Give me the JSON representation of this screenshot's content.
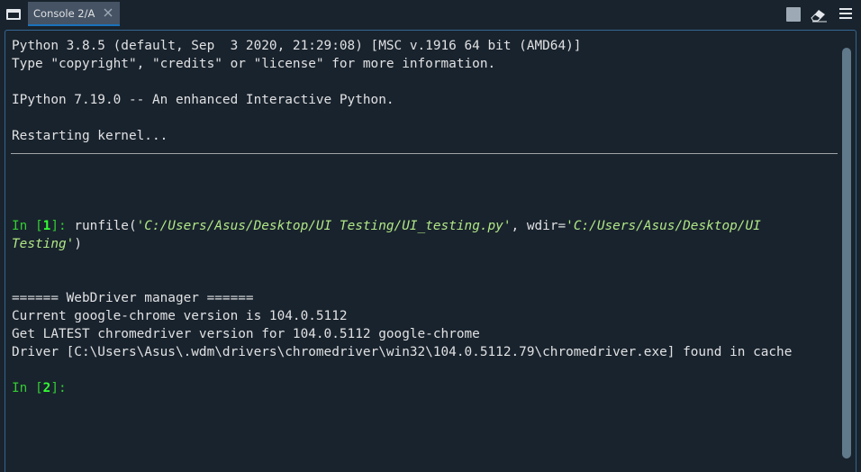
{
  "tabbar": {
    "window_icon": "window-icon",
    "tab_label": "Console 2/A",
    "close_icon": "close-icon",
    "stop_icon": "stop-icon",
    "eraser_icon": "eraser-icon",
    "menu_icon": "hamburger-menu-icon"
  },
  "console": {
    "banner_line1": "Python 3.8.5 (default, Sep  3 2020, 21:29:08) [MSC v.1916 64 bit (AMD64)]",
    "banner_line2": "Type \"copyright\", \"credits\" or \"license\" for more information.",
    "banner_line3": "IPython 7.19.0 -- An enhanced Interactive Python.",
    "restart_msg": "Restarting kernel...",
    "cell1": {
      "prompt_prefix": "In [",
      "prompt_num": "1",
      "prompt_suffix": "]: ",
      "code_start": "runfile(",
      "path_str": "'C:/Users/Asus/Desktop/UI Testing/UI_testing.py'",
      "code_mid": ", wdir=",
      "wdir_str_part1": "'C:/Users/Asus/Desktop/UI",
      "wdir_str_part2": "Testing'",
      "code_end": ")"
    },
    "output": [
      "====== WebDriver manager ======",
      "Current google-chrome version is 104.0.5112",
      "Get LATEST chromedriver version for 104.0.5112 google-chrome",
      "Driver [C:\\Users\\Asus\\.wdm\\drivers\\chromedriver\\win32\\104.0.5112.79\\chromedriver.exe] found in cache"
    ],
    "cell2": {
      "prompt_prefix": "In [",
      "prompt_num": "2",
      "prompt_suffix": "]:"
    }
  },
  "colors": {
    "background": "#19232d",
    "text": "#e0e1e3",
    "prompt": "#33cc33",
    "string": "#b0e686",
    "tab_accent": "#1a72bb"
  }
}
